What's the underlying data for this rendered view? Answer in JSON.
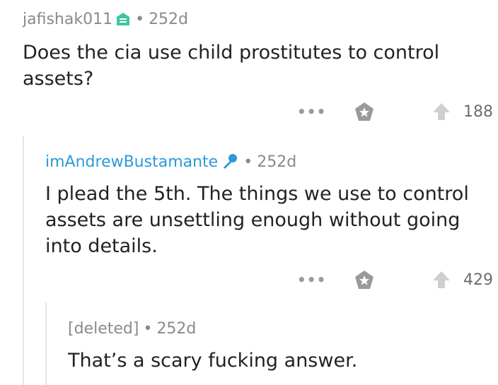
{
  "comments": [
    {
      "username": "jafishak011",
      "age": "252d",
      "text": "Does the cia use child prostitutes to control assets?",
      "more_label": "•••",
      "votes": "188"
    },
    {
      "username": "imAndrewBustamante",
      "age": "252d",
      "text": "I plead the 5th. The things we use to control assets are unsettling enough without going into details.",
      "more_label": "•••",
      "votes": "429"
    },
    {
      "username": "[deleted]",
      "age": "252d",
      "text": "That’s a scary fucking answer."
    }
  ],
  "colors": {
    "op_username": "#2a9bd8",
    "flair": "#3cc5a2",
    "award": "#9a9a9a",
    "thread_line": "#e5e5e5"
  },
  "icons": {
    "flair_1": "shield-badge-icon",
    "flair_2": "microphone-icon",
    "award": "award-star-icon",
    "upvote": "upvote-arrow-icon"
  }
}
